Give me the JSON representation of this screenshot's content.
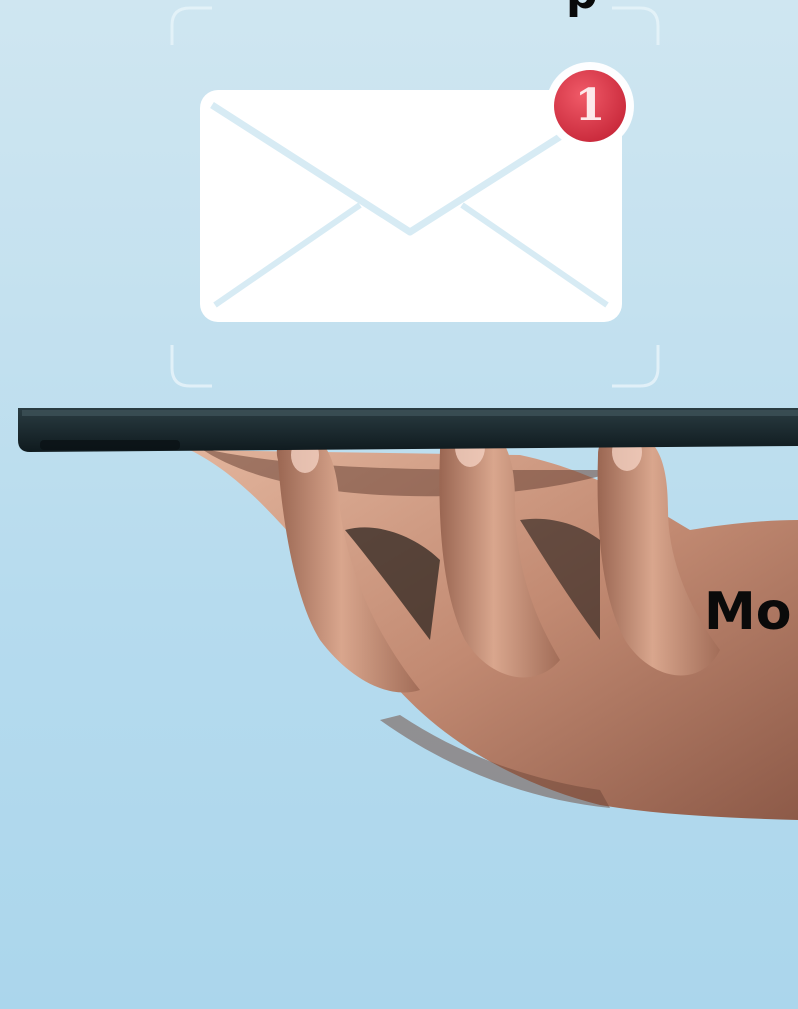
{
  "overlay_text": {
    "top_fragment": "p",
    "middle_fragment": "Mo"
  },
  "notification": {
    "icon": "envelope-icon",
    "badge_count": "1"
  },
  "colors": {
    "background_top": "#cfe6f1",
    "background_bottom": "#abd6ec",
    "envelope": "#ffffff",
    "badge": "#e0384a",
    "phone": "#1b2a2f",
    "skin": "#c9917a"
  }
}
